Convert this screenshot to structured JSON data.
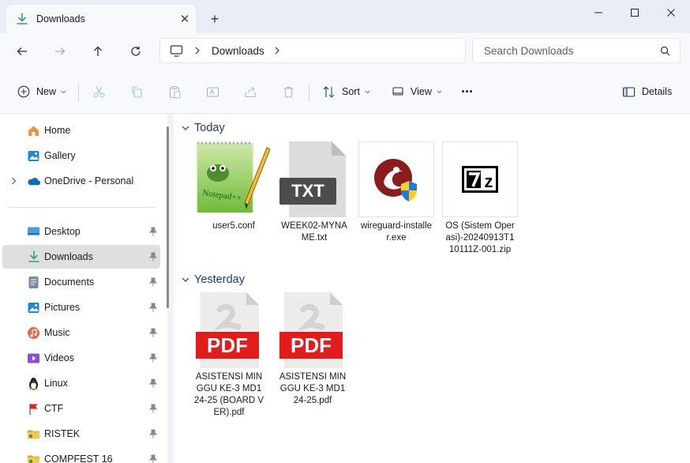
{
  "window": {
    "tab_title": "Downloads",
    "tab_close": "✕",
    "new_tab": "+"
  },
  "address": {
    "crumbs": [
      "Downloads"
    ],
    "search_placeholder": "Search Downloads"
  },
  "commands": {
    "new": "New",
    "sort": "Sort",
    "view": "View",
    "more": "···",
    "details": "Details"
  },
  "sidebar": {
    "top_items": [
      {
        "label": "Home",
        "icon": "home-icon"
      },
      {
        "label": "Gallery",
        "icon": "gallery-icon"
      },
      {
        "label": "OneDrive - Personal",
        "icon": "onedrive-icon"
      }
    ],
    "pinned_items": [
      {
        "label": "Desktop",
        "icon": "desktop-icon"
      },
      {
        "label": "Downloads",
        "icon": "downloads-icon",
        "selected": true
      },
      {
        "label": "Documents",
        "icon": "documents-icon"
      },
      {
        "label": "Pictures",
        "icon": "pictures-icon"
      },
      {
        "label": "Music",
        "icon": "music-icon"
      },
      {
        "label": "Videos",
        "icon": "videos-icon"
      },
      {
        "label": "Linux",
        "icon": "linux-penguin-icon"
      },
      {
        "label": "CTF",
        "icon": "red-flag-icon"
      },
      {
        "label": "RISTEK",
        "icon": "folder-icon"
      },
      {
        "label": "COMPFEST 16",
        "icon": "folder-icon"
      }
    ]
  },
  "groups": [
    {
      "title": "Today",
      "files": [
        {
          "name": "user5.conf",
          "icon": "notepad-plus-plus-icon"
        },
        {
          "name": "WEEK02-MYNAME.txt",
          "icon": "txt-file-icon"
        },
        {
          "name": "wireguard-installer.exe",
          "icon": "installer-icon"
        },
        {
          "name": "OS (Sistem Operasi)-20240913T110111Z-001.zip",
          "icon": "7zip-icon"
        }
      ]
    },
    {
      "title": "Yesterday",
      "files": [
        {
          "name": "ASISTENSI MINGGU KE-3 MD1 24-25 (BOARD VER).pdf",
          "icon": "pdf-icon"
        },
        {
          "name": "ASISTENSI MINGGU KE-3 MD1 24-25.pdf",
          "icon": "pdf-icon"
        }
      ]
    }
  ],
  "colors": {
    "accent": "#0067c0",
    "download_green": "#2ea46f",
    "pdf_red": "#e31b1b",
    "group_header": "#1d3a68"
  }
}
